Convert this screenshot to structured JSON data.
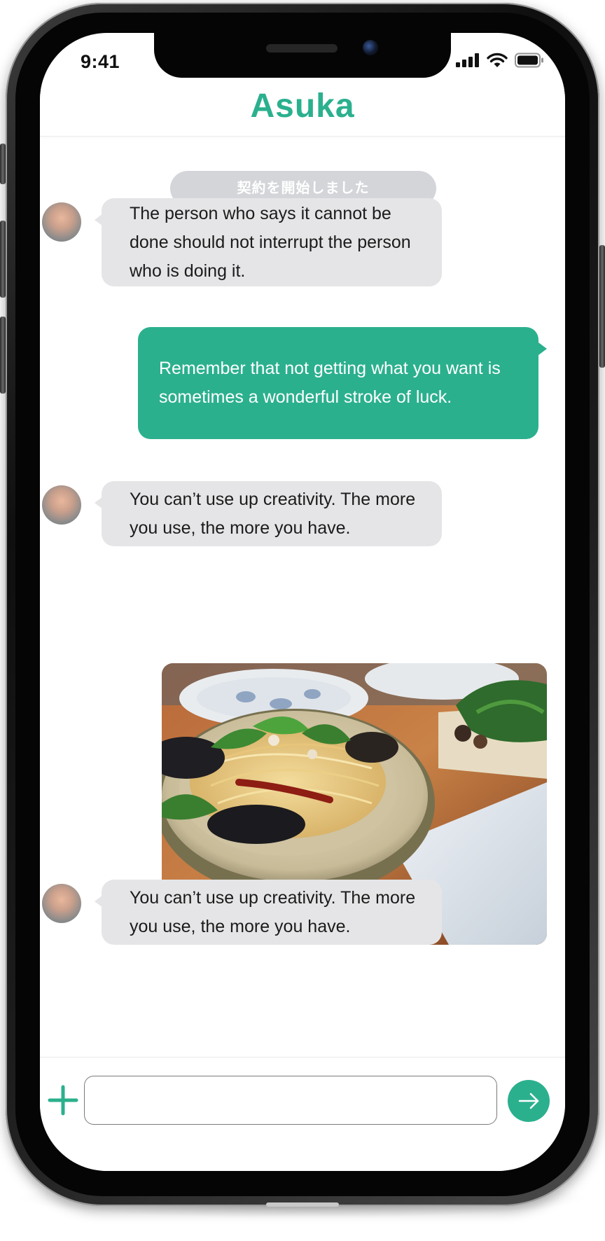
{
  "status_bar": {
    "time": "9:41"
  },
  "header": {
    "title": "Asuka"
  },
  "chat": {
    "system_notice": "契約を開始しました",
    "messages": [
      {
        "sender": "Asuka",
        "text": "The person who says it cannot be done should not interrupt the person who is doing it."
      },
      {
        "sender": "me",
        "text": "Remember that not getting what you want is sometimes a wonderful stroke of luck."
      },
      {
        "sender": "Asuka",
        "text": "You can’t use up creativity. The more you use, the more you have."
      },
      {
        "sender": "me",
        "type": "image",
        "image": "pasta-dish-photo"
      },
      {
        "sender": "Asuka",
        "text": "You can’t use up creativity. The more you use, the more you have."
      }
    ]
  },
  "composer": {
    "placeholder": "",
    "value": ""
  },
  "icons": {
    "add": "plus-icon",
    "send": "arrow-right-icon",
    "signal": "cellular-signal-icon",
    "wifi": "wifi-icon",
    "battery": "battery-icon"
  },
  "colors": {
    "accent": "#2bb08e",
    "incoming_bubble": "#e5e5e7",
    "system_pill": "#d3d5d9"
  }
}
